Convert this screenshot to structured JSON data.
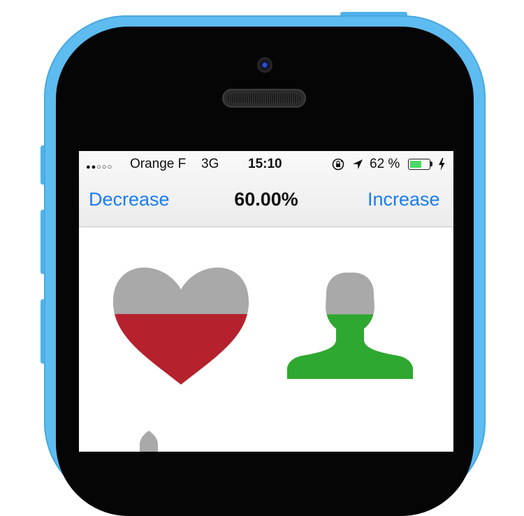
{
  "status_bar": {
    "signal_dots": "●●○○○",
    "carrier": "Orange F",
    "network": "3G",
    "time": "15:10",
    "battery_percent": "62 %",
    "battery_level": 0.62,
    "icons": [
      "rotation-lock-icon",
      "location-arrow-icon",
      "battery-icon",
      "charging-bolt-icon"
    ]
  },
  "nav": {
    "decrease_label": "Decrease",
    "title": "60.00%",
    "increase_label": "Increase"
  },
  "shapes": {
    "fill_level": 0.6,
    "empty_color": "#a9a9a9",
    "heart_color": "#b5212d",
    "person_color": "#2ea830"
  },
  "colors": {
    "accent": "#1a7cf5",
    "phone_body": "#5ebcf0"
  }
}
